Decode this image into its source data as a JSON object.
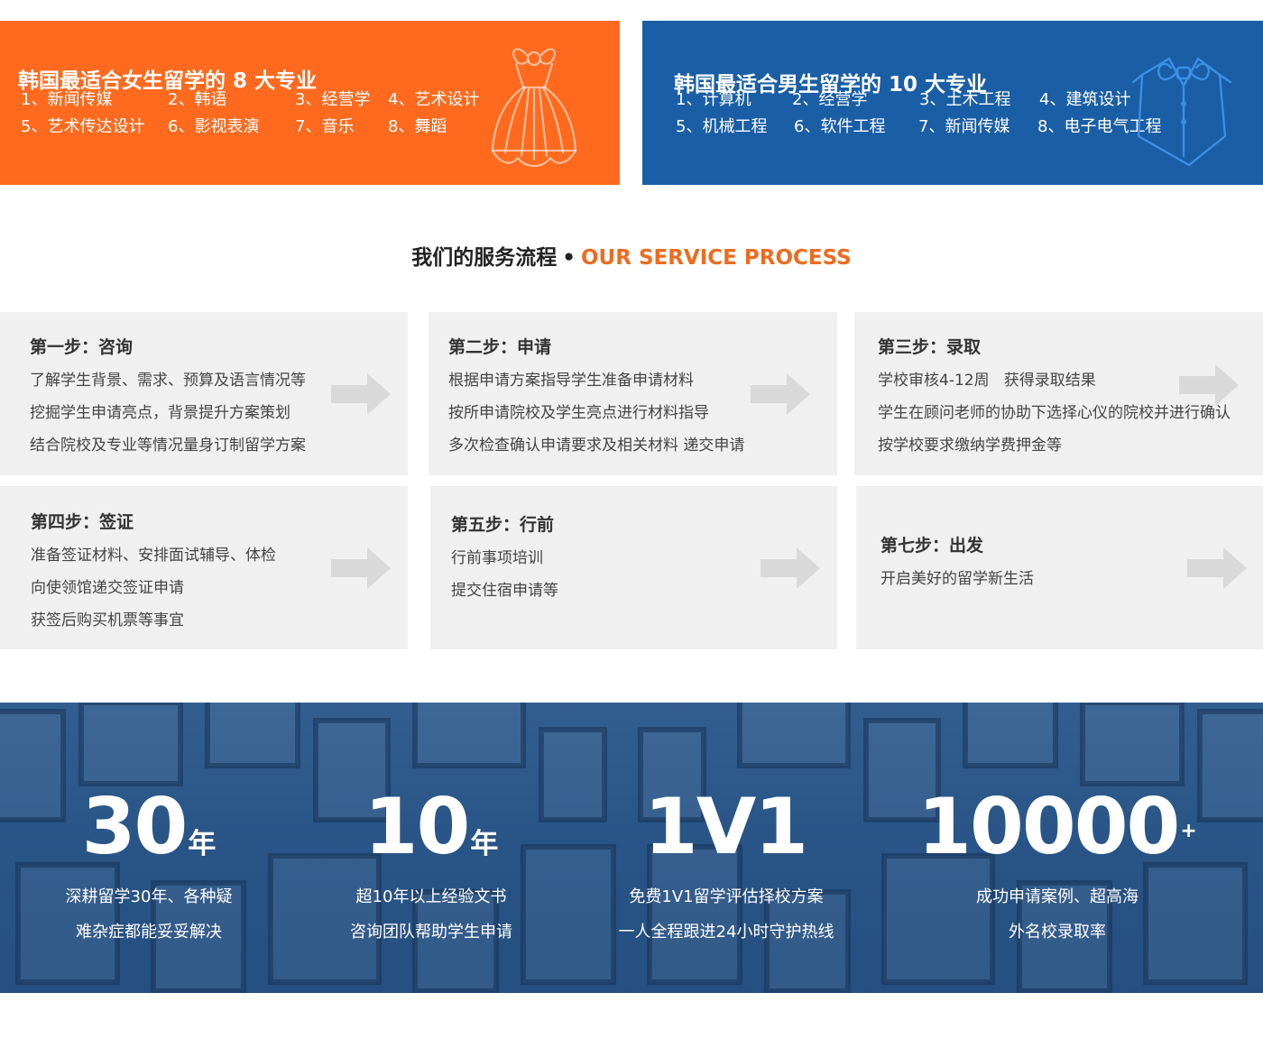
{
  "majors": {
    "female": {
      "title": "韩国最适合女生留学的 8 大专业",
      "items": [
        "1、新闻传媒",
        "2、韩语",
        "3、经营学",
        "4、艺术设计",
        "5、艺术传达设计",
        "6、影视表演",
        "7、音乐",
        "8、舞蹈"
      ],
      "icon": "dress-icon",
      "color": "#ff6a1e"
    },
    "male": {
      "title": "韩国最适合男生留学的 10 大专业",
      "items": [
        "1、计算机",
        "2、经营学",
        "3、土木工程",
        "4、建筑设计",
        "5、机械工程",
        "6、软件工程",
        "7、新闻传媒",
        "8、电子电气工程"
      ],
      "icon": "tuxedo-icon",
      "color": "#1a5ea6"
    }
  },
  "process": {
    "title_cn": "我们的服务流程",
    "separator": "•",
    "title_en": "OUR SERVICE PROCESS",
    "accent": "#ee6b1f",
    "steps": [
      {
        "title": "第一步：咨询",
        "lines": [
          "了解学生背景、需求、预算及语言情况等",
          "挖掘学生申请亮点，背景提升方案策划",
          "结合院校及专业等情况量身订制留学方案"
        ]
      },
      {
        "title": "第二步：申请",
        "lines": [
          "根据申请方案指导学生准备申请材料",
          "按所申请院校及学生亮点进行材料指导",
          "多次检查确认申请要求及相关材料 递交申请"
        ]
      },
      {
        "title": "第三步：录取",
        "lines": [
          "学校审核4-12周   获得录取结果",
          "学生在顾问老师的协助下选择心仪的院校并进行确认",
          "按学校要求缴纳学费押金等"
        ]
      },
      {
        "title": "第四步：签证",
        "lines": [
          "准备签证材料、安排面试辅导、体检",
          "向使领馆递交签证申请",
          "获签后购买机票等事宜"
        ]
      },
      {
        "title": "第五步：行前",
        "lines": [
          "行前事项培训",
          "提交住宿申请等"
        ]
      },
      {
        "title": "第七步：出发",
        "lines": [
          "开启美好的留学新生活"
        ]
      }
    ]
  },
  "stats": [
    {
      "value": "30",
      "unit": "年",
      "lines": [
        "深耕留学30年、各种疑",
        "难杂症都能妥妥解决"
      ]
    },
    {
      "value": "10",
      "unit": "年",
      "lines": [
        "超10年以上经验文书",
        "咨询团队帮助学生申请"
      ]
    },
    {
      "value": "1V1",
      "unit": "",
      "lines": [
        "免费1V1留学评估择校方案",
        "一人全程跟进24小时守护热线"
      ]
    },
    {
      "value": "10000",
      "unit": "+",
      "lines": [
        "成功申请案例、超高海",
        "外名校录取率"
      ]
    }
  ]
}
